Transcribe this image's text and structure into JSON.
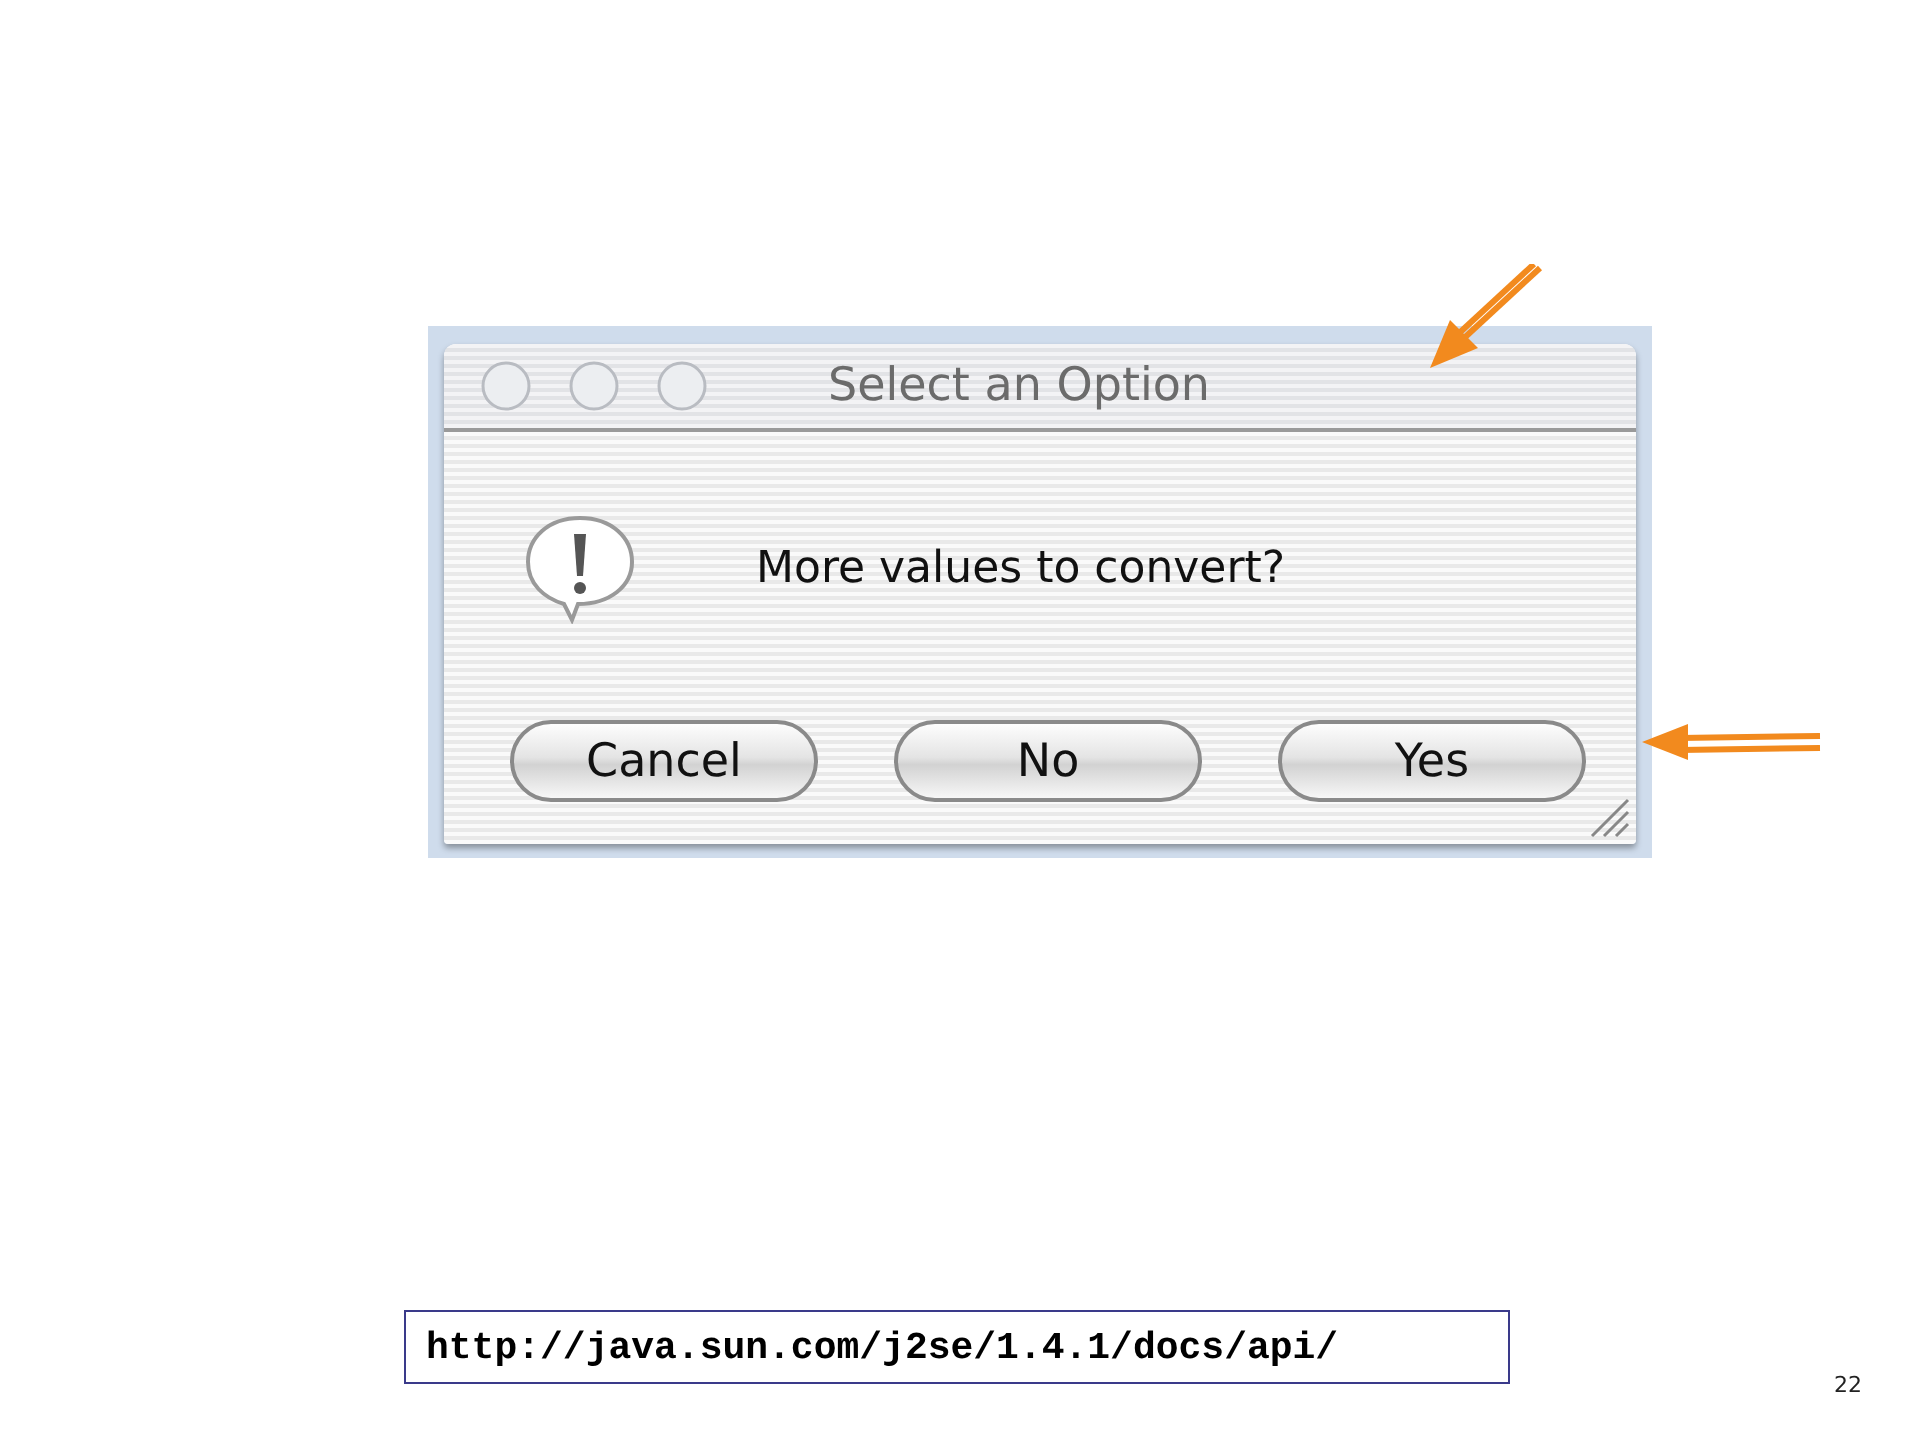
{
  "dialog": {
    "title": "Select an Option",
    "message": "More values to convert?",
    "buttons": [
      {
        "label": "Cancel"
      },
      {
        "label": "No"
      },
      {
        "label": "Yes"
      }
    ]
  },
  "url": "http://java.sun.com/j2se/1.4.1/docs/api/",
  "page_number": "22"
}
